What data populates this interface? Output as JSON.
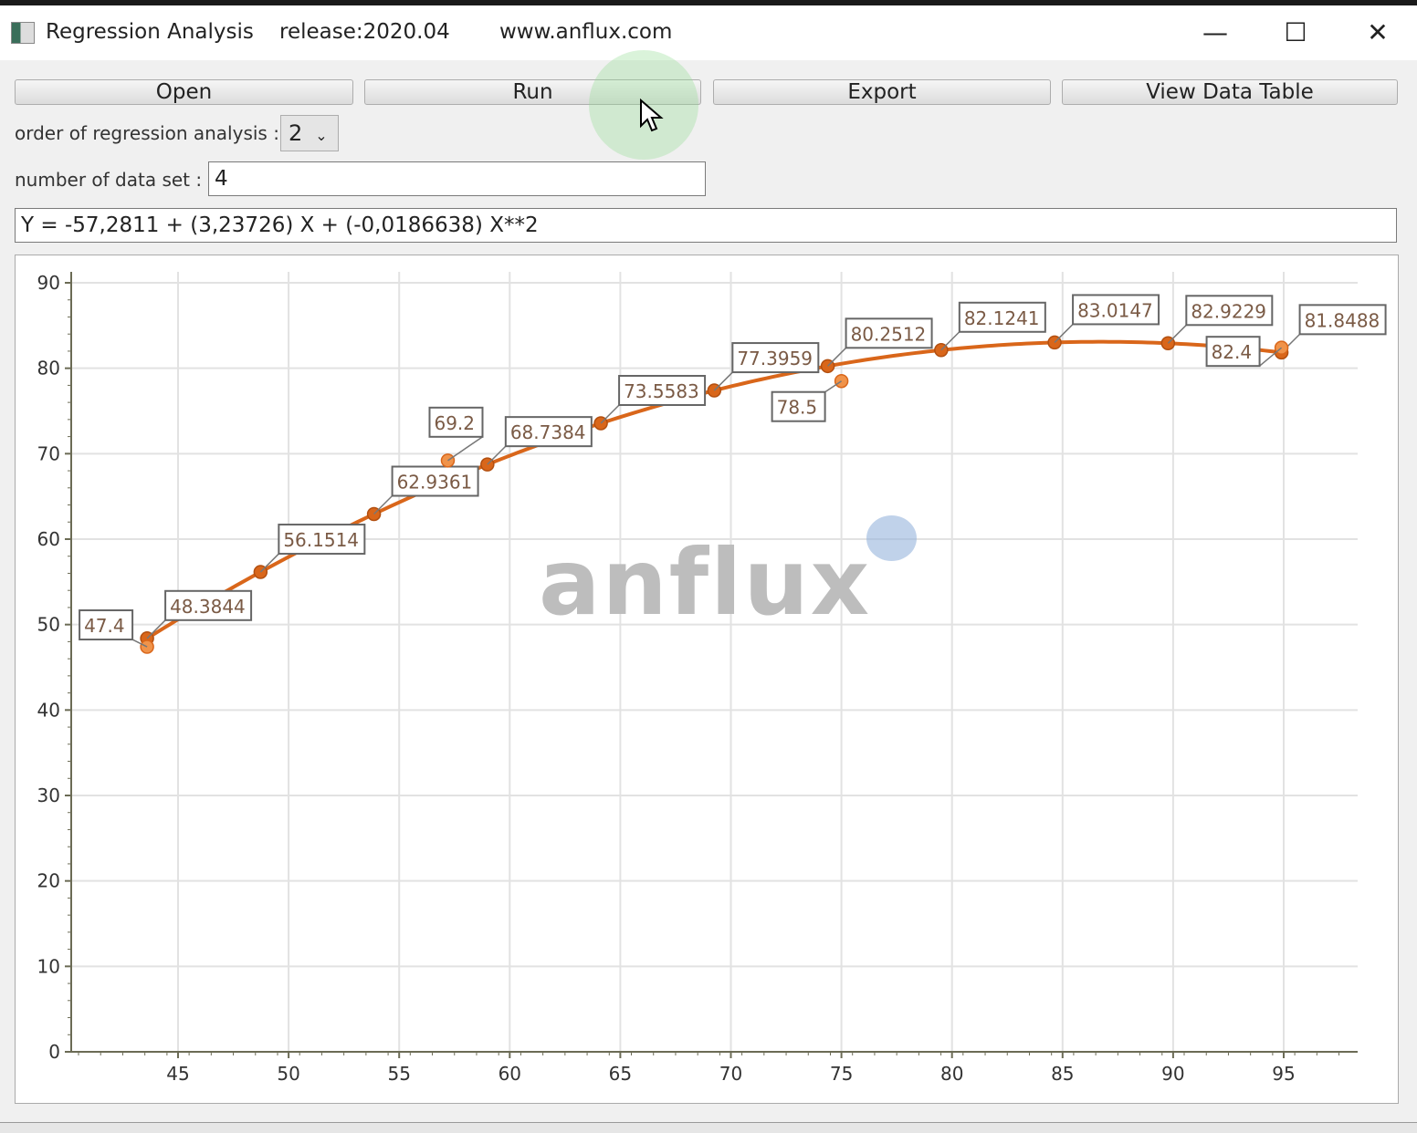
{
  "window": {
    "title": "Regression Analysis",
    "release": "release:2020.04",
    "website": "www.anflux.com",
    "controls": [
      "minimize-icon",
      "maximize-icon",
      "close-icon"
    ]
  },
  "toolbar": {
    "open": "Open",
    "run": "Run",
    "export": "Export",
    "view_table": "View Data Table"
  },
  "form": {
    "order_label": "order of regression analysis :",
    "order_value": "2",
    "dataset_label": "number of data set :",
    "dataset_value": "4",
    "equation": "Y = -57,2811 + (3,23726) X + (-0,0186638) X**2"
  },
  "watermark": "anflux",
  "colors": {
    "fit": "#d9661a",
    "data": "#f0934a",
    "grid": "#e2e2e2",
    "axis": "#6b6b55"
  },
  "chart_data": {
    "type": "scatter",
    "xlim": [
      40,
      98
    ],
    "ylim": [
      0,
      90
    ],
    "xticks": [
      45,
      50,
      55,
      60,
      65,
      70,
      75,
      80,
      85,
      90,
      95
    ],
    "yticks": [
      0,
      10,
      20,
      30,
      40,
      50,
      60,
      70,
      80,
      90
    ],
    "grid": true,
    "series": [
      {
        "kind": "fit-line",
        "x": [
          43.6,
          48.73,
          53.86,
          58.99,
          64.12,
          69.25,
          74.38,
          79.51,
          84.64,
          89.77,
          94.9
        ],
        "y": [
          48.3844,
          56.1514,
          62.9361,
          68.7384,
          73.5583,
          77.3959,
          80.2512,
          82.1241,
          83.0147,
          82.9229,
          81.8488
        ],
        "labels": [
          "48.3844",
          "56.1514",
          "62.9361",
          "68.7384",
          "73.5583",
          "77.3959",
          "80.2512",
          "82.1241",
          "83.0147",
          "82.9229",
          "81.8488"
        ]
      },
      {
        "kind": "data-points",
        "x": [
          43.6,
          57.2,
          75.0,
          94.9
        ],
        "y": [
          47.4,
          69.2,
          78.5,
          82.4
        ],
        "labels": [
          "47.4",
          "69.2",
          "78.5",
          "82.4"
        ]
      }
    ]
  }
}
